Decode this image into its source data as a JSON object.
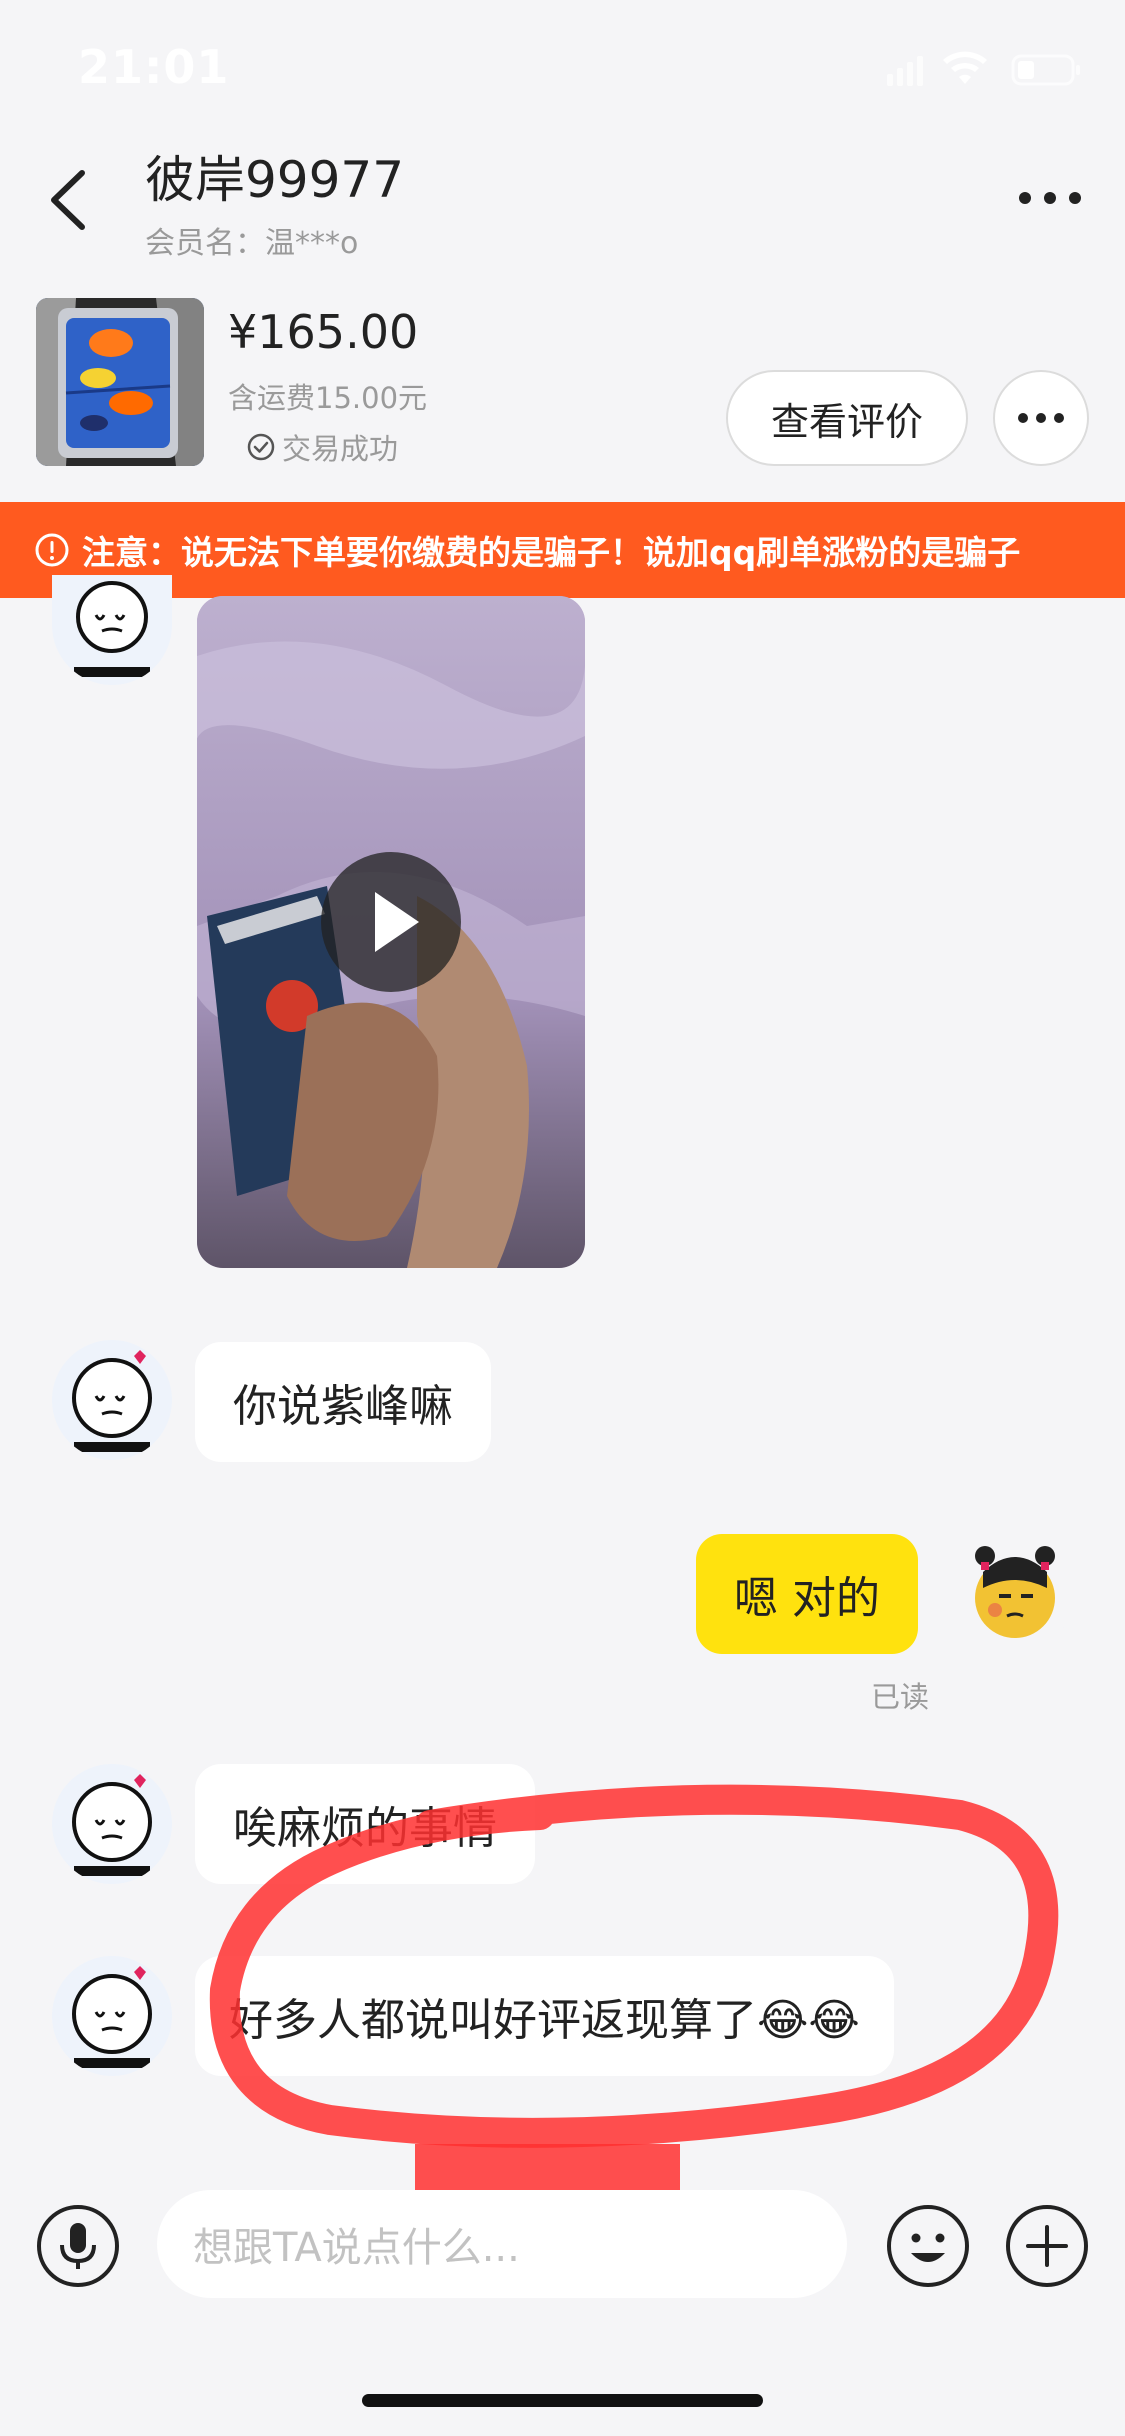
{
  "status_bar": {
    "time": "21:01"
  },
  "header": {
    "back_icon": "chevron-left-icon",
    "title": "彼岸99977",
    "subtitle": "会员名：温***o",
    "more_icon": "more-horizontal-icon"
  },
  "product": {
    "price": "¥165.00",
    "shipping": "含运费15.00元",
    "status": "交易成功",
    "review_label": "查看评价"
  },
  "warning": {
    "text": "注意：说无法下单要你缴费的是骗子！说加qq刷单涨粉的是骗子"
  },
  "messages": [
    {
      "side": "left",
      "type": "video"
    },
    {
      "side": "left",
      "type": "text",
      "text": "你说紫峰嘛"
    },
    {
      "side": "right",
      "type": "text",
      "text": "嗯 对的",
      "read_status": "已读"
    },
    {
      "side": "left",
      "type": "text",
      "text": "唉麻烦的事情"
    },
    {
      "side": "left",
      "type": "text",
      "text": "好多人都说叫好评返现算了😂😂"
    }
  ],
  "input_bar": {
    "placeholder": "想跟TA说点什么..."
  },
  "colors": {
    "warning": "#ff5a1f",
    "own_bubble": "#ffe20e",
    "annotation": "#ff3030"
  }
}
